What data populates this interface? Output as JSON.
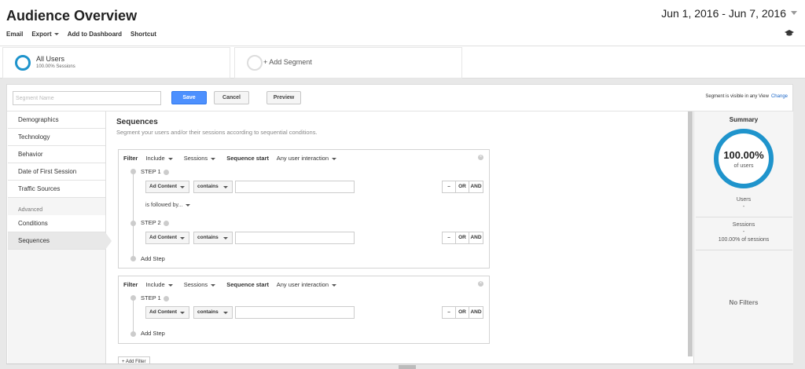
{
  "header": {
    "title": "Audience Overview",
    "date_range": "Jun 1, 2016 - Jun 7, 2016",
    "actions": [
      "Email",
      "Export",
      "Add to Dashboard",
      "Shortcut"
    ]
  },
  "segments": {
    "active": {
      "name": "All Users",
      "sub": "100.00% Sessions"
    },
    "add_label": "+ Add Segment"
  },
  "editor": {
    "name_placeholder": "Segment Name",
    "save": "Save",
    "cancel": "Cancel",
    "preview": "Preview",
    "visibility_text": "Segment is visible in any View",
    "visibility_link": "Change"
  },
  "nav": {
    "items": [
      "Demographics",
      "Technology",
      "Behavior",
      "Date of First Session",
      "Traffic Sources"
    ],
    "advanced_label": "Advanced",
    "advanced_items": [
      "Conditions",
      "Sequences"
    ]
  },
  "content": {
    "title": "Sequences",
    "description": "Segment your users and/or their sessions according to sequential conditions."
  },
  "filters": [
    {
      "label": "Filter",
      "include": "Include",
      "scope": "Sessions",
      "seq_label": "Sequence start",
      "seq_value": "Any user interaction",
      "steps": [
        {
          "label": "STEP 1",
          "dimension": "Ad Content",
          "operator": "contains",
          "value": ""
        },
        {
          "label": "STEP 2",
          "dimension": "Ad Content",
          "operator": "contains",
          "value": ""
        }
      ],
      "followed_by": "is followed by...",
      "add_step": "Add Step"
    },
    {
      "label": "Filter",
      "include": "Include",
      "scope": "Sessions",
      "seq_label": "Sequence start",
      "seq_value": "Any user interaction",
      "steps": [
        {
          "label": "STEP 1",
          "dimension": "Ad Content",
          "operator": "contains",
          "value": ""
        }
      ],
      "add_step": "Add Step"
    }
  ],
  "logic": {
    "minus": "–",
    "or": "OR",
    "and": "AND"
  },
  "add_filter": "+ Add Filter",
  "summary": {
    "title": "Summary",
    "percent": "100.00%",
    "percent_sub": "of users",
    "users_label": "Users",
    "users_value": "-",
    "sessions_label": "Sessions",
    "sessions_value": "-",
    "sessions_pct": "100.00% of sessions",
    "no_filters": "No Filters"
  },
  "colors": {
    "accent": "#1f94cc",
    "save_button": "#4d90fe",
    "link": "#1a66c7"
  }
}
